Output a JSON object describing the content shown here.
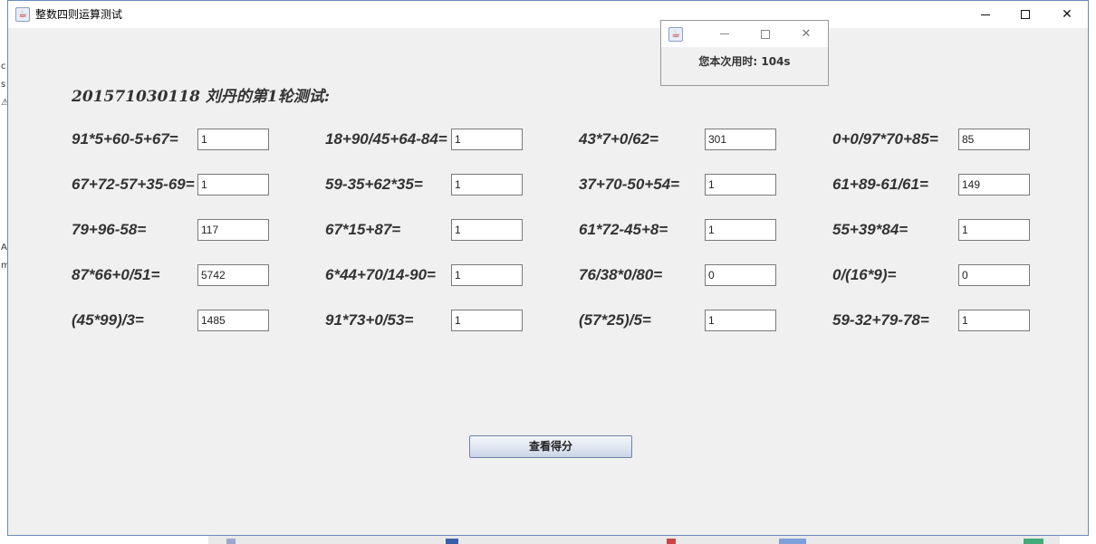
{
  "window": {
    "title": "整数四则运算测试"
  },
  "heading": "201571030118  刘丹的第1轮测试:",
  "questions": [
    {
      "expr": "91*5+60-5+67=",
      "answer": "1"
    },
    {
      "expr": "18+90/45+64-84=",
      "answer": "1"
    },
    {
      "expr": "43*7+0/62=",
      "answer": "301"
    },
    {
      "expr": "0+0/97*70+85=",
      "answer": "85"
    },
    {
      "expr": "67+72-57+35-69=",
      "answer": "1"
    },
    {
      "expr": "59-35+62*35=",
      "answer": "1"
    },
    {
      "expr": "37+70-50+54=",
      "answer": "1"
    },
    {
      "expr": "61+89-61/61=",
      "answer": "149"
    },
    {
      "expr": "79+96-58=",
      "answer": "117"
    },
    {
      "expr": "67*15+87=",
      "answer": "1"
    },
    {
      "expr": "61*72-45+8=",
      "answer": "1"
    },
    {
      "expr": "55+39*84=",
      "answer": "1"
    },
    {
      "expr": "87*66+0/51=",
      "answer": "5742"
    },
    {
      "expr": "6*44+70/14-90=",
      "answer": "1"
    },
    {
      "expr": "76/38*0/80=",
      "answer": "0"
    },
    {
      "expr": "0/(16*9)=",
      "answer": "0"
    },
    {
      "expr": "(45*99)/3=",
      "answer": "1485"
    },
    {
      "expr": "91*73+0/53=",
      "answer": "1"
    },
    {
      "expr": "(57*25)/5=",
      "answer": "1"
    },
    {
      "expr": "59-32+79-78=",
      "answer": "1"
    }
  ],
  "score_button": "查看得分",
  "dialog": {
    "timer_text": "您本次用时:  104s"
  },
  "icons": {
    "app": "java-coffee-icon",
    "minimize": "minimize-icon",
    "maximize": "maximize-icon",
    "close": "close-icon"
  }
}
